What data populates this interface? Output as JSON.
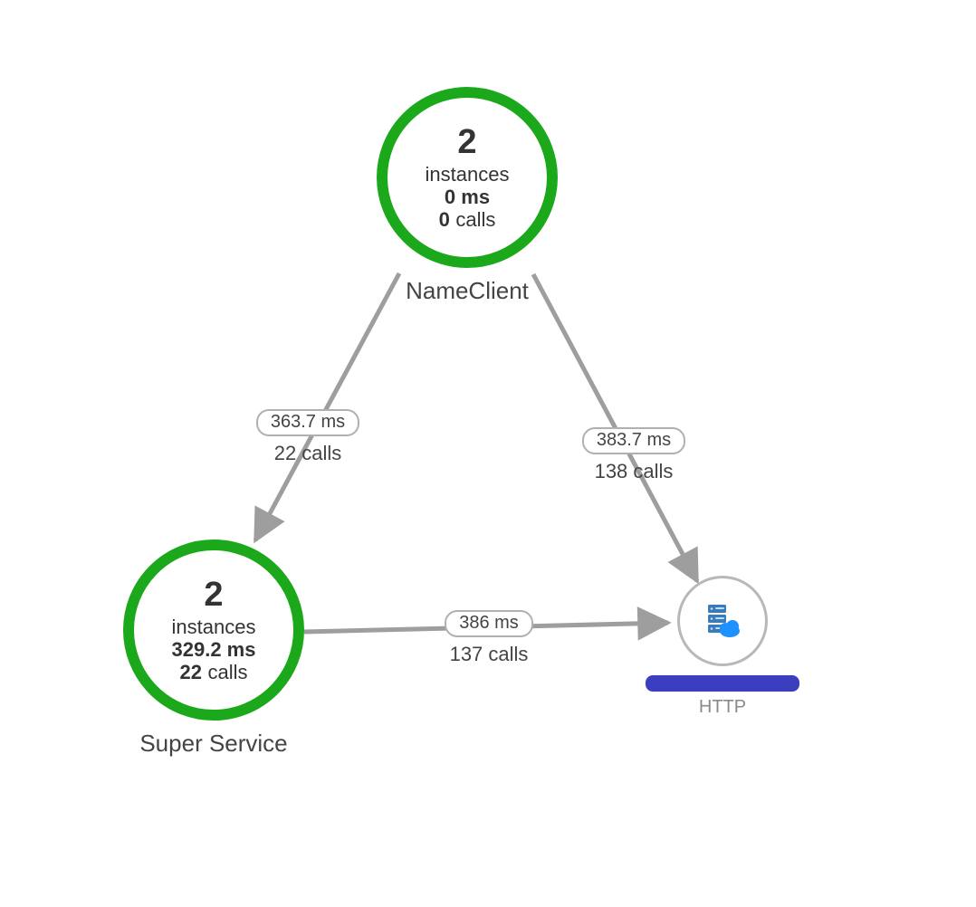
{
  "nodes": {
    "nameClient": {
      "instances": "2",
      "instancesLabel": "instances",
      "latency": "0 ms",
      "calls": "0",
      "callsLabel": "calls",
      "title": "NameClient"
    },
    "superService": {
      "instances": "2",
      "instancesLabel": "instances",
      "latency": "329.2 ms",
      "calls": "22",
      "callsLabel": "calls",
      "title": "Super Service"
    },
    "http": {
      "subtype": "HTTP"
    }
  },
  "edges": {
    "nameClient_superService": {
      "latency": "363.7 ms",
      "calls": "22 calls"
    },
    "nameClient_http": {
      "latency": "383.7 ms",
      "calls": "138 calls"
    },
    "superService_http": {
      "latency": "386 ms",
      "calls": "137 calls"
    }
  },
  "colors": {
    "healthyRing": "#1ba81b",
    "edge": "#9e9e9e",
    "redaction": "#3b3fbf"
  }
}
